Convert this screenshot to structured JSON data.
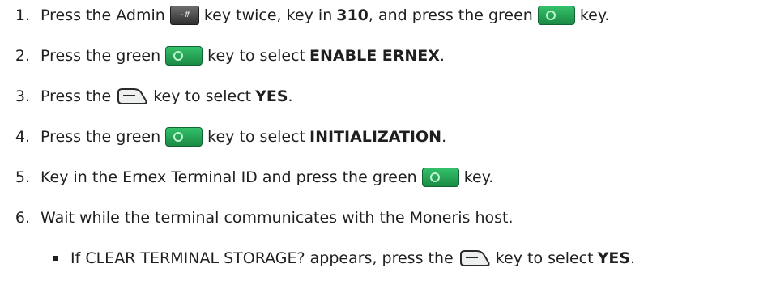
{
  "steps": [
    {
      "num": "1.",
      "a": "Press the Admin",
      "b": "key twice, key in",
      "c": "310",
      "d": ", and press the green",
      "e": "key."
    },
    {
      "num": "2.",
      "a": "Press the green",
      "b": "key to select",
      "c": "ENABLE ERNEX",
      "d": "."
    },
    {
      "num": "3.",
      "a": "Press the",
      "b": "key to select",
      "c": "YES",
      "d": "."
    },
    {
      "num": "4.",
      "a": "Press the green",
      "b": "key to select",
      "c": "INITIALIZATION",
      "d": "."
    },
    {
      "num": "5.",
      "a": "Key in the Ernex Terminal ID and press the green",
      "b": "key."
    },
    {
      "num": "6.",
      "a": "Wait while the terminal communicates with the Moneris host."
    }
  ],
  "bullet": {
    "a": "If CLEAR TERMINAL STORAGE? appears, press the",
    "b": "key to select",
    "c": "YES",
    "d": "."
  },
  "icons": {
    "admin": "admin-key-icon",
    "green": "green-ok-key-icon",
    "clear": "clear-key-icon",
    "admin_glyph": "-#"
  }
}
